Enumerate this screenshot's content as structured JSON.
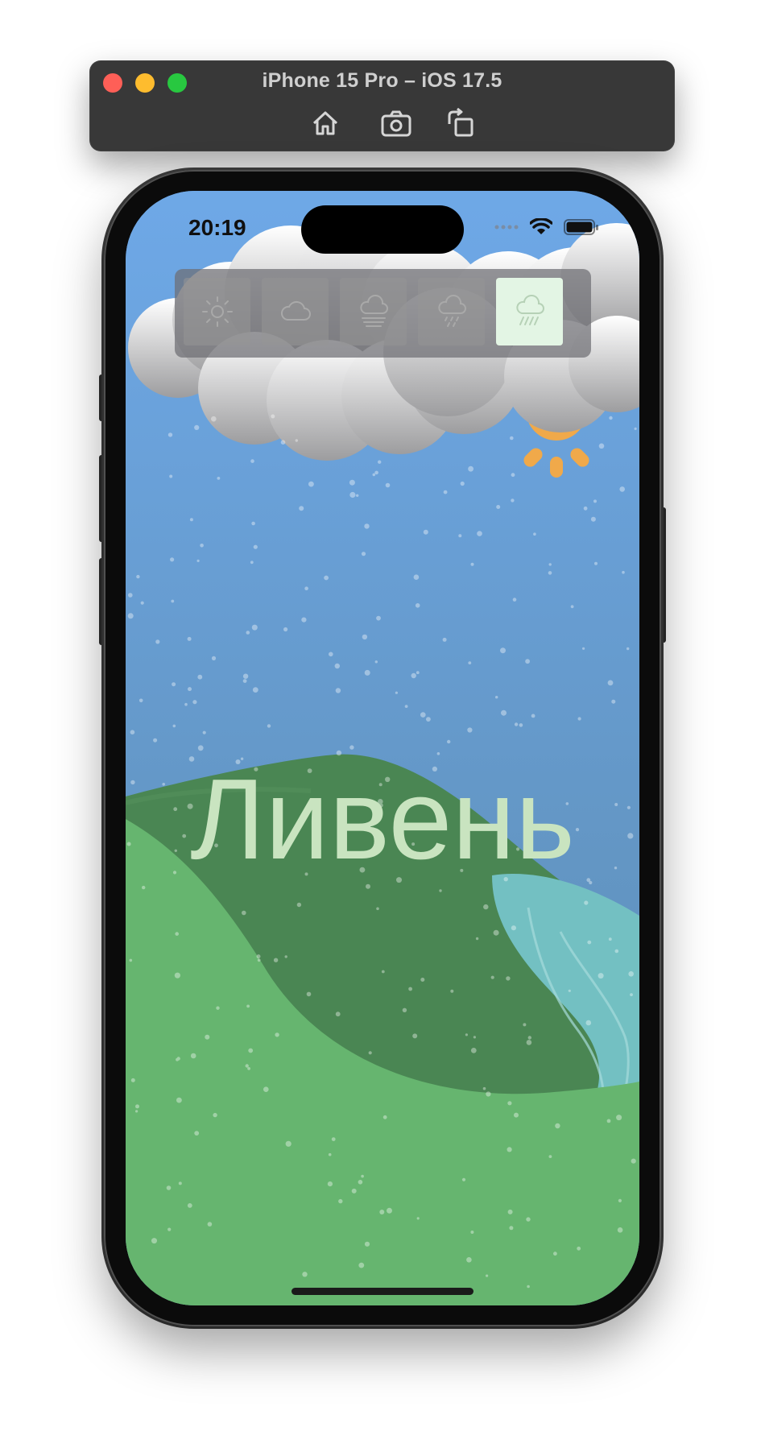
{
  "window": {
    "title": "iPhone 15 Pro – iOS 17.5",
    "toolbar": [
      {
        "icon": "home-icon"
      },
      {
        "icon": "screenshot-icon"
      },
      {
        "icon": "rotate-icon"
      }
    ]
  },
  "status_bar": {
    "time": "20:19",
    "icons": [
      "cellular-icon",
      "wifi-icon",
      "battery-icon"
    ]
  },
  "weather_selector": {
    "options": [
      {
        "icon": "sun-icon",
        "selected": false
      },
      {
        "icon": "cloud-icon",
        "selected": false
      },
      {
        "icon": "fog-icon",
        "selected": false
      },
      {
        "icon": "rain-icon",
        "selected": false
      },
      {
        "icon": "heavy-rain-icon",
        "selected": true
      }
    ]
  },
  "scene": {
    "title": "Ливень",
    "colors": {
      "sky": "#6fa7e6",
      "hill_dark": "#4a8653",
      "hill_light": "#66b56f",
      "water": "#73c0c2",
      "sun": "#f0a94a",
      "title_text": "#c9e4c0"
    }
  }
}
